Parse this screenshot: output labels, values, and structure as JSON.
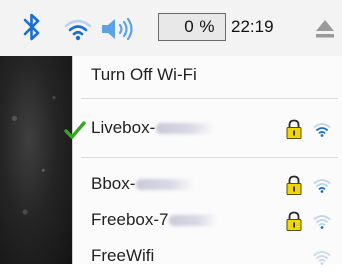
{
  "taskbar": {
    "icons": [
      "bluetooth-icon",
      "wifi-icon",
      "volume-icon",
      "eject-icon"
    ],
    "cpu_usage": "0 %",
    "clock": "22:19",
    "accent_color": "#1a6fd4"
  },
  "wifi_menu": {
    "toggle_label": "Turn Off Wi-Fi",
    "networks": [
      {
        "name": "Livebox-",
        "connected": true,
        "secured": true,
        "signal_icon": "wifi-signal-icon"
      },
      {
        "name": "Bbox-",
        "connected": false,
        "secured": true,
        "signal_icon": "wifi-signal-icon"
      },
      {
        "name": "Freebox-7",
        "connected": false,
        "secured": true,
        "signal_icon": "wifi-signal-icon"
      },
      {
        "name": "FreeWifi",
        "connected": false,
        "secured": false,
        "signal_icon": "wifi-signal-icon"
      }
    ],
    "check_color": "#2eaa1c",
    "lock_color": "#f2d600"
  }
}
